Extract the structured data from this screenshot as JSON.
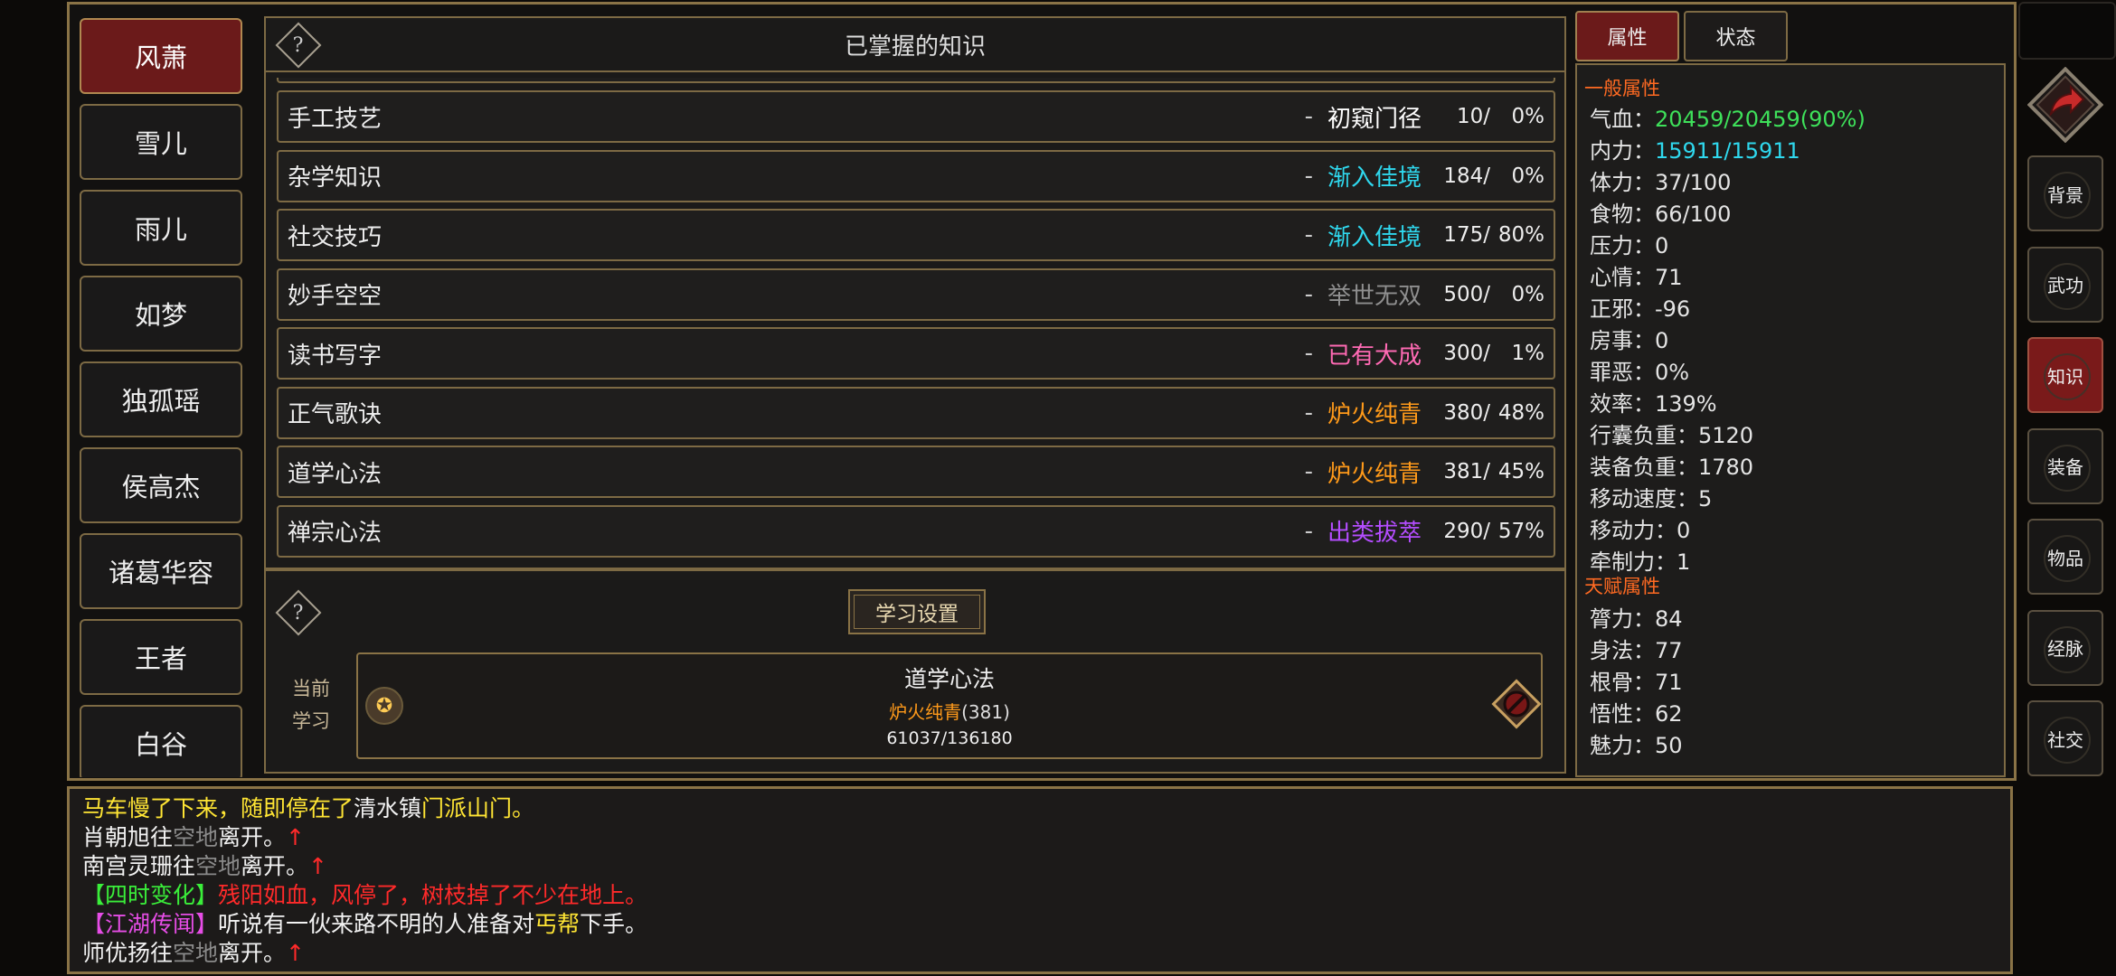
{
  "characters": [
    "风萧",
    "雪儿",
    "雨儿",
    "如梦",
    "独孤瑶",
    "侯高杰",
    "诸葛华容",
    "王者",
    "白谷"
  ],
  "knowledge": {
    "header_title": "已掌握的知识",
    "skills": [
      {
        "name": "手工技艺",
        "level": "初窥门径",
        "level_color": "#ffffff",
        "points": "10/",
        "pct": "0%"
      },
      {
        "name": "杂学知识",
        "level": "渐入佳境",
        "level_color": "#2fd8ee",
        "points": "184/",
        "pct": "0%"
      },
      {
        "name": "社交技巧",
        "level": "渐入佳境",
        "level_color": "#2fd8ee",
        "points": "175/",
        "pct": "80%"
      },
      {
        "name": "妙手空空",
        "level": "举世无双",
        "level_color": "#8f8f8f",
        "points": "500/",
        "pct": "0%"
      },
      {
        "name": "读书写字",
        "level": "已有大成",
        "level_color": "#ff6ab4",
        "points": "300/",
        "pct": "1%"
      },
      {
        "name": "正气歌诀",
        "level": "炉火纯青",
        "level_color": "#ff9a1a",
        "points": "380/",
        "pct": "48%"
      },
      {
        "name": "道学心法",
        "level": "炉火纯青",
        "level_color": "#ff9a1a",
        "points": "381/",
        "pct": "45%"
      },
      {
        "name": "禅宗心法",
        "level": "出类拔萃",
        "level_color": "#b44dff",
        "points": "290/",
        "pct": "57%"
      }
    ],
    "dash": "-"
  },
  "study": {
    "settings_label": "学习设置",
    "current_label_1": "当前",
    "current_label_2": "学习",
    "current_name": "道学心法",
    "current_level": "炉火纯青",
    "current_level_num": "(381)",
    "current_progress": "61037/136180"
  },
  "tabs": {
    "attributes": "属性",
    "status": "状态"
  },
  "attributes": {
    "general_title": "一般属性",
    "general": [
      {
        "label": "气血：",
        "value": "20459/20459(90%)",
        "color": "green"
      },
      {
        "label": "内力：",
        "value": "15911/15911",
        "color": "cyan"
      },
      {
        "label": "体力：",
        "value": "37/100",
        "color": ""
      },
      {
        "label": "食物：",
        "value": "66/100",
        "color": ""
      },
      {
        "label": "压力：",
        "value": "0",
        "color": ""
      },
      {
        "label": "心情：",
        "value": "71",
        "color": ""
      },
      {
        "label": "正邪：",
        "value": "-96",
        "color": ""
      },
      {
        "label": "房事：",
        "value": "0",
        "color": ""
      },
      {
        "label": "罪恶：",
        "value": "0%",
        "color": ""
      },
      {
        "label": "效率：",
        "value": "139%",
        "color": ""
      },
      {
        "label": "行囊负重：",
        "value": "5120",
        "color": ""
      },
      {
        "label": "装备负重：",
        "value": "1780",
        "color": ""
      },
      {
        "label": "移动速度：",
        "value": "5",
        "color": ""
      },
      {
        "label": "移动力：",
        "value": "0",
        "color": ""
      },
      {
        "label": "牵制力：",
        "value": "1",
        "color": ""
      }
    ],
    "talent_title": "天赋属性",
    "talent": [
      {
        "label": "膂力：",
        "value": "84"
      },
      {
        "label": "身法：",
        "value": "77"
      },
      {
        "label": "根骨：",
        "value": "71"
      },
      {
        "label": "悟性：",
        "value": "62"
      },
      {
        "label": "魅力：",
        "value": "50"
      }
    ]
  },
  "side_menu": [
    "背景",
    "武功",
    "知识",
    "装备",
    "物品",
    "经脉",
    "社交"
  ],
  "side_menu_active": "知识",
  "log": [
    [
      {
        "t": "马车慢了下来，随即停在了",
        "c": "y"
      },
      {
        "t": "清水镇",
        "c": "w"
      },
      {
        "t": "门派山门。",
        "c": "y"
      }
    ],
    [
      {
        "t": "肖朝旭往",
        "c": "w"
      },
      {
        "t": "空地",
        "c": "g"
      },
      {
        "t": "离开。",
        "c": "w"
      },
      {
        "t": "↑",
        "c": "r"
      }
    ],
    [
      {
        "t": "南宫灵珊往",
        "c": "w"
      },
      {
        "t": "空地",
        "c": "g"
      },
      {
        "t": "离开。",
        "c": "w"
      },
      {
        "t": "↑",
        "c": "r"
      }
    ],
    [
      {
        "t": "【四时变化】",
        "c": "gr"
      },
      {
        "t": "残阳如血，风停了，树枝掉了不少在地上。",
        "c": "r"
      }
    ],
    [
      {
        "t": "【江湖传闻】",
        "c": "m"
      },
      {
        "t": "听说有一伙来路不明的人准备对",
        "c": "w"
      },
      {
        "t": "丐帮",
        "c": "y"
      },
      {
        "t": "下手。",
        "c": "w"
      }
    ],
    [
      {
        "t": "师优扬往",
        "c": "w"
      },
      {
        "t": "空地",
        "c": "g"
      },
      {
        "t": "离开。",
        "c": "w"
      },
      {
        "t": "↑",
        "c": "r"
      }
    ]
  ]
}
